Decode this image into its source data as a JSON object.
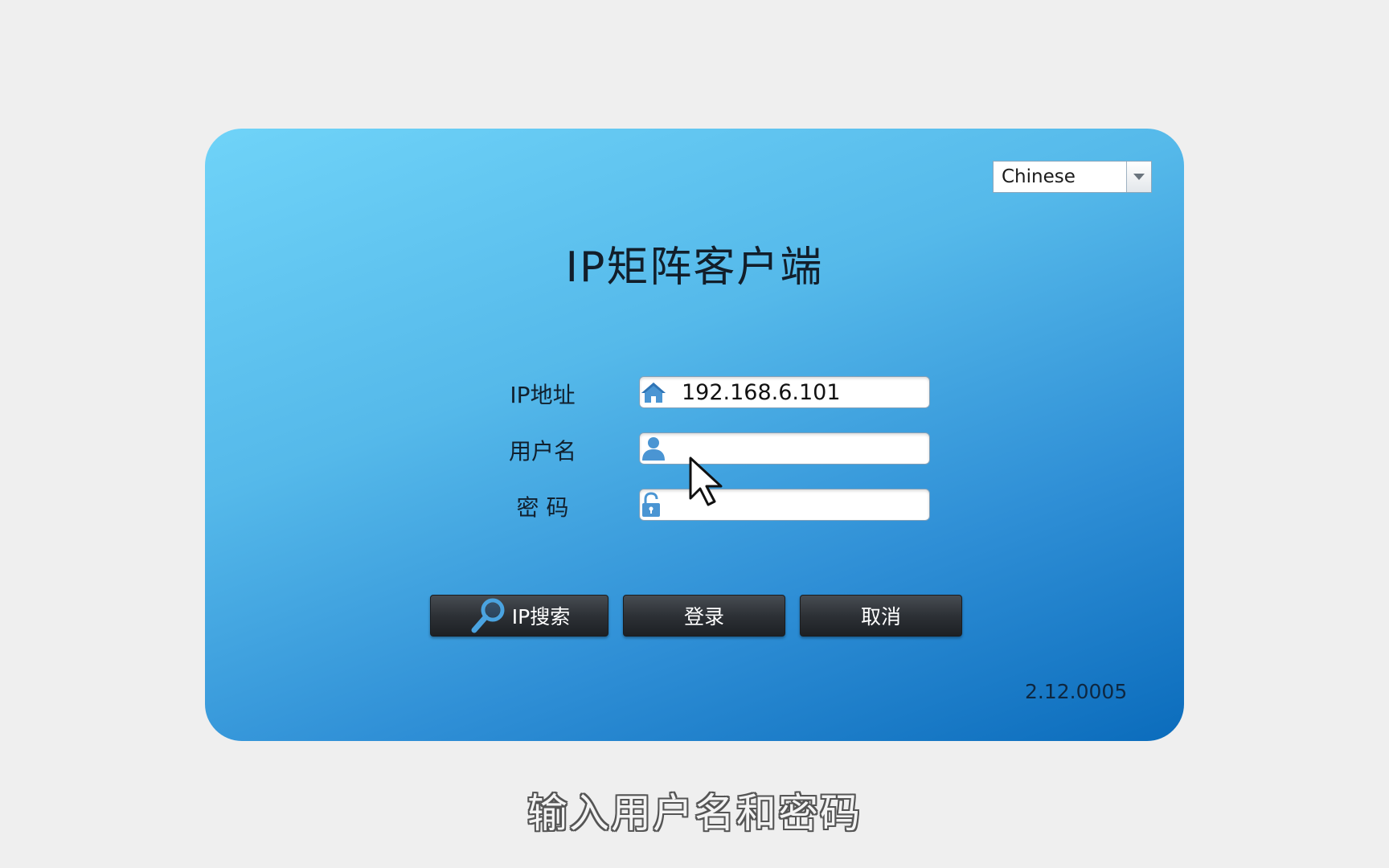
{
  "window": {
    "title": "IP矩阵客户端",
    "version": "2.12.0005"
  },
  "language": {
    "selected": "Chinese",
    "icon": "chevron-down-icon"
  },
  "form": {
    "ip": {
      "label": "IP地址",
      "value": "192.168.6.101",
      "icon": "home-icon"
    },
    "username": {
      "label": "用户名",
      "value": "",
      "icon": "user-icon"
    },
    "password": {
      "label": "密 码",
      "value": "",
      "icon": "lock-icon"
    }
  },
  "buttons": {
    "search_label": "IP搜索",
    "search_icon": "magnifier-icon",
    "login_label": "登录",
    "cancel_label": "取消"
  },
  "caption": "输入用户名和密码",
  "colors": {
    "panel_light": "#6fd3f8",
    "panel_dark": "#0b6cbc",
    "button_dark": "#2d3136",
    "icon_blue": "#3f8fd0"
  }
}
